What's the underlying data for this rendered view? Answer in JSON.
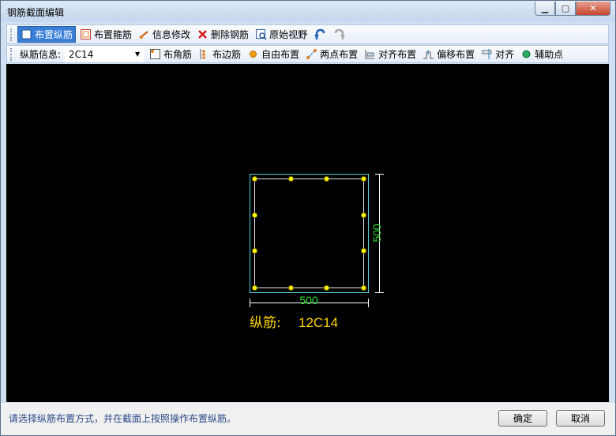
{
  "window": {
    "title": "钢筋截面编辑"
  },
  "toolbar1": {
    "buttons": [
      {
        "label": "布置纵筋",
        "icon": "rebar-longitudinal-icon"
      },
      {
        "label": "布置箍筋",
        "icon": "stirrup-icon"
      },
      {
        "label": "信息修改",
        "icon": "edit-info-icon"
      },
      {
        "label": "删除钢筋",
        "icon": "delete-x-icon"
      },
      {
        "label": "原始视野",
        "icon": "zoom-fit-icon"
      }
    ],
    "undo_icon": "undo-icon",
    "redo_icon": "redo-icon"
  },
  "toolbar2": {
    "info_label": "纵筋信息:",
    "info_value": "2C14",
    "buttons": [
      {
        "label": "布角筋",
        "icon": "corner-bar-icon"
      },
      {
        "label": "布边筋",
        "icon": "side-bar-icon"
      },
      {
        "label": "自由布置",
        "icon": "free-place-icon"
      },
      {
        "label": "两点布置",
        "icon": "two-point-icon"
      },
      {
        "label": "对齐布置",
        "icon": "align-place-icon"
      },
      {
        "label": "偏移布置",
        "icon": "offset-place-icon"
      },
      {
        "label": "对齐",
        "icon": "align-icon"
      },
      {
        "label": "辅助点",
        "icon": "aux-point-icon"
      }
    ]
  },
  "drawing": {
    "width_dim": "500",
    "height_dim": "500",
    "rebar_label": "纵筋:",
    "rebar_value": "12C14",
    "colors": {
      "outline": "#4fd0d8",
      "bar": "#ffff00",
      "dim": "#33dd33",
      "text": "#ffd400"
    }
  },
  "status": {
    "message": "请选择纵筋布置方式，并在截面上按照操作布置纵筋。",
    "ok_label": "确定",
    "cancel_label": "取消"
  }
}
